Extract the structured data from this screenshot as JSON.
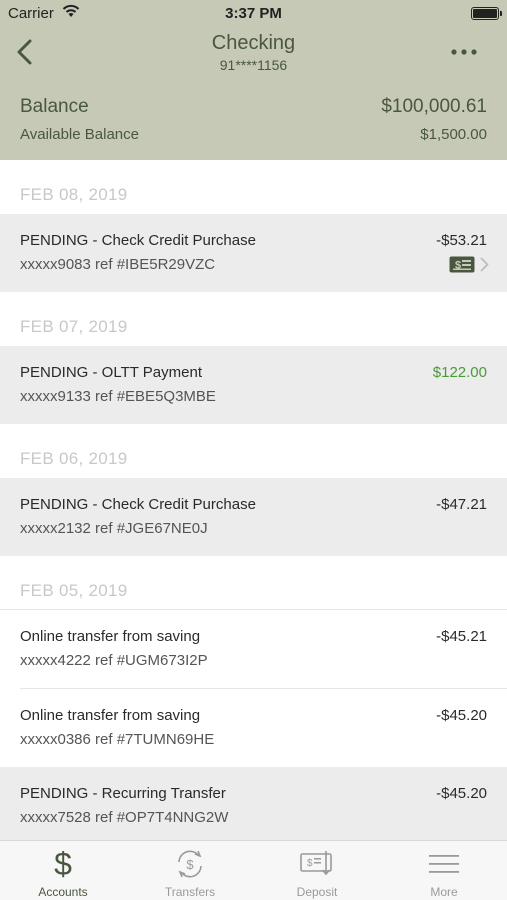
{
  "status_bar": {
    "carrier": "Carrier",
    "time": "3:37 PM"
  },
  "nav": {
    "title": "Checking",
    "subtitle": "91****1156",
    "back_icon": "chevron-left-icon",
    "more_icon": "ellipsis-icon"
  },
  "balance": {
    "balance_label": "Balance",
    "balance_value": "$100,000.61",
    "available_label": "Available Balance",
    "available_value": "$1,500.00"
  },
  "groups": [
    {
      "date": "FEB 08, 2019",
      "items": [
        {
          "desc": "PENDING - Check Credit Purchase",
          "ref": "xxxxx9083 ref #IBE5R29VZC",
          "amount": "-$53.21",
          "pending": true,
          "has_check_icon": true
        }
      ]
    },
    {
      "date": "FEB 07, 2019",
      "items": [
        {
          "desc": "PENDING - OLTT Payment",
          "ref": "xxxxx9133 ref #EBE5Q3MBE",
          "amount": "$122.00",
          "pending": true,
          "credit": true
        }
      ]
    },
    {
      "date": "FEB 06, 2019",
      "items": [
        {
          "desc": "PENDING - Check Credit Purchase",
          "ref": "xxxxx2132 ref #JGE67NE0J",
          "amount": "-$47.21",
          "pending": true
        }
      ]
    },
    {
      "date": "FEB 05, 2019",
      "items": [
        {
          "desc": "Online transfer from saving",
          "ref": "xxxxx4222 ref #UGM673I2P",
          "amount": "-$45.21",
          "pending": false
        },
        {
          "desc": "Online transfer from saving",
          "ref": "xxxxx0386 ref #7TUMN69HE",
          "amount": "-$45.20",
          "pending": false
        },
        {
          "desc": "PENDING - Recurring Transfer",
          "ref": "xxxxx7528 ref #OP7T4NNG2W",
          "amount": "-$45.20",
          "pending": true
        }
      ]
    }
  ],
  "tabbar": {
    "tabs": [
      {
        "label": "Accounts",
        "icon": "dollar-icon",
        "active": true
      },
      {
        "label": "Transfers",
        "icon": "transfer-cycle-icon",
        "active": false
      },
      {
        "label": "Deposit",
        "icon": "check-deposit-icon",
        "active": false
      },
      {
        "label": "More",
        "icon": "menu-icon",
        "active": false
      }
    ]
  },
  "colors": {
    "header_bg": "#c5c9b6",
    "header_text": "#4a5740",
    "credit_green": "#4a9a3a",
    "pending_row_bg": "#ececec"
  }
}
